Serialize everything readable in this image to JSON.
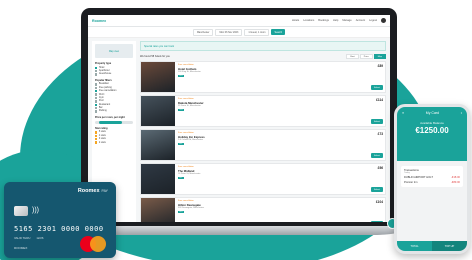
{
  "colors": {
    "accent": "#1aa39a",
    "dark_accent": "#15576f"
  },
  "app": {
    "logo": "Roomex",
    "nav": [
      "Hotels",
      "Locations",
      "Bookings",
      "Help",
      "Manage",
      "Account",
      "Logout"
    ]
  },
  "search": {
    "destination": "Manchester",
    "checkin": "Mon 06 Nov 2023",
    "guests": "1 Guest, 1 room",
    "button": "Search"
  },
  "filters": {
    "map_label": "Map view",
    "property_type_title": "Property type",
    "property_types": [
      {
        "label": "Hotel",
        "checked": true
      },
      {
        "label": "Aparthotel",
        "checked": false
      },
      {
        "label": "Guesthouse",
        "checked": false
      }
    ],
    "facilities_title": "Popular filters",
    "facilities": [
      {
        "label": "Breakfast",
        "checked": false
      },
      {
        "label": "Free parking",
        "checked": false
      },
      {
        "label": "Free cancellation",
        "checked": true
      },
      {
        "label": "Wi-Fi",
        "checked": false
      },
      {
        "label": "Gym",
        "checked": false
      },
      {
        "label": "Pool",
        "checked": false
      },
      {
        "label": "Restaurant",
        "checked": true
      },
      {
        "label": "Bar",
        "checked": false
      },
      {
        "label": "Parking",
        "checked": false
      }
    ],
    "price_title": "Price per room, per night",
    "star_title": "Star rating",
    "stars": [
      "5 stars",
      "4 stars",
      "3 stars",
      "2 stars"
    ]
  },
  "main": {
    "banner": "Special rates you can book",
    "results_label": "We found 58 hotels for you",
    "sort_options": [
      {
        "label": "Best",
        "active": false
      },
      {
        "label": "Price",
        "active": false
      },
      {
        "label": "Map",
        "active": true
      }
    ],
    "hotels": [
      {
        "tag": "Free cancellation",
        "name": "Hotel Gotham",
        "address": "100 King St, Manchester",
        "rating": "8.9",
        "price": "£89",
        "button": "Select",
        "img": "#6b4a3a"
      },
      {
        "tag": "Free cancellation",
        "name": "Dakota Manchester",
        "address": "29 Ducie St, Manchester",
        "rating": "9.0",
        "price": "£114",
        "button": "Select",
        "img": "#46525c"
      },
      {
        "tag": "Free cancellation",
        "name": "Holiday Inn Express",
        "address": "2-4 Oxford Rd, Manchester",
        "rating": "8.1",
        "price": "£73",
        "button": "Select",
        "img": "#5b6a74"
      },
      {
        "tag": "Free cancellation",
        "name": "The Midland",
        "address": "16 Peter St, Manchester",
        "rating": "8.7",
        "price": "£96",
        "button": "Select",
        "img": "#2f3944"
      },
      {
        "tag": "Free cancellation",
        "name": "Hilton Deansgate",
        "address": "303 Deansgate, Manchester",
        "rating": "8.5",
        "price": "£104",
        "button": "Select",
        "img": "#7a5b49"
      }
    ]
  },
  "phone": {
    "title": "My Card",
    "balance_label": "Available Balance",
    "balance": "€1250.00",
    "section_title": "Transactions",
    "section_sub": "Today",
    "transactions": [
      {
        "label": "DUBLIN AIRPORT HOLT",
        "amount": "-€18.00"
      },
      {
        "label": "Premier Inn",
        "amount": "-€89.00"
      }
    ],
    "tabs": [
      "TOTAL",
      "TOP UP"
    ]
  },
  "card": {
    "brand": "Roomex",
    "brand_sub": "PAY",
    "number": "5165 2301 0000 0000",
    "valid_label": "VALID THRU",
    "valid": "12/26",
    "holder": "ROOMEX"
  }
}
